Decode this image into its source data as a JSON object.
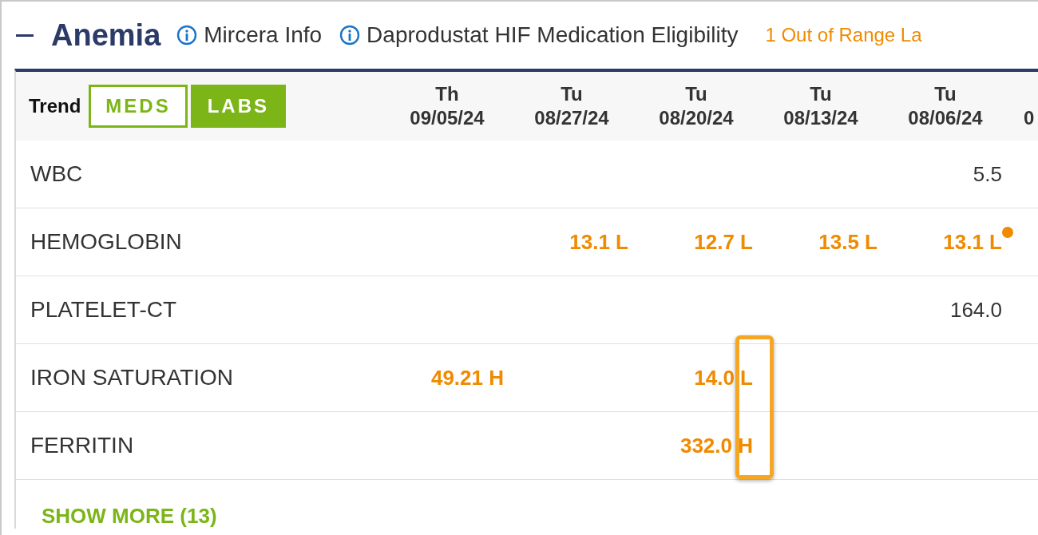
{
  "section": {
    "title": "Anemia",
    "expanded": true,
    "links": [
      "Mircera Info",
      "Daprodustat HIF Medication Eligibility"
    ],
    "alert": "1 Out of Range La"
  },
  "table": {
    "trend_label": "Trend",
    "toggles": [
      {
        "label": "MEDS",
        "selected": false
      },
      {
        "label": "LABS",
        "selected": true
      }
    ],
    "columns": [
      {
        "day": "Th",
        "date": "09/05/24"
      },
      {
        "day": "Tu",
        "date": "08/27/24"
      },
      {
        "day": "Tu",
        "date": "08/20/24"
      },
      {
        "day": "Tu",
        "date": "08/13/24"
      },
      {
        "day": "Tu",
        "date": "08/06/24"
      },
      {
        "date": "0"
      }
    ],
    "rows": [
      {
        "name": "WBC",
        "cells": [
          null,
          null,
          null,
          null,
          {
            "text": "5.5",
            "abnormal": false,
            "dot": false
          },
          null
        ]
      },
      {
        "name": "HEMOGLOBIN",
        "cells": [
          null,
          {
            "text": "13.1 L",
            "abnormal": true,
            "dot": false
          },
          {
            "text": "12.7 L",
            "abnormal": true,
            "dot": false
          },
          {
            "text": "13.5 L",
            "abnormal": true,
            "dot": false
          },
          {
            "text": "13.1 L",
            "abnormal": true,
            "dot": true
          },
          null
        ]
      },
      {
        "name": "PLATELET-CT",
        "cells": [
          null,
          null,
          null,
          null,
          {
            "text": "164.0",
            "abnormal": false,
            "dot": false
          },
          null
        ]
      },
      {
        "name": "IRON SATURATION",
        "cells": [
          {
            "text": "49.21 H",
            "abnormal": true,
            "dot": false
          },
          null,
          {
            "text": "14.0 L",
            "abnormal": true,
            "dot": false
          },
          null,
          null,
          null
        ]
      },
      {
        "name": "FERRITIN",
        "cells": [
          null,
          null,
          {
            "text": "332.0 H",
            "abnormal": true,
            "dot": false
          },
          null,
          null,
          null
        ]
      }
    ],
    "show_more": "SHOW MORE (13)"
  }
}
